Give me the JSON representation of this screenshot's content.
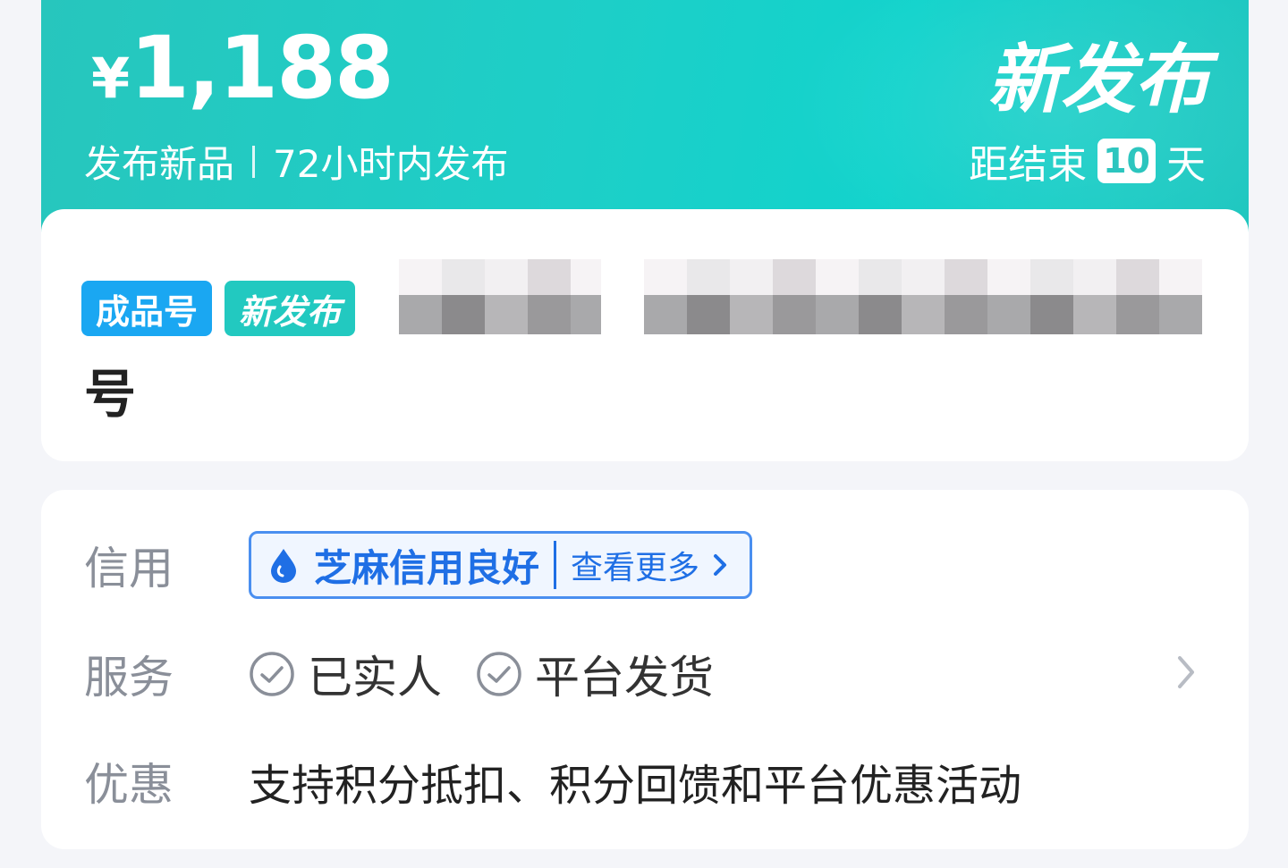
{
  "hero": {
    "currency": "¥",
    "price": "1,188",
    "subtitle_left": "发布新品",
    "subtitle_right": "72小时内发布",
    "badge": "新发布",
    "countdown_prefix": "距结束",
    "countdown_days": "10",
    "countdown_suffix": "天"
  },
  "title_card": {
    "tags": [
      "成品号",
      "新发布"
    ],
    "title_tail": "号"
  },
  "info": {
    "credit": {
      "label": "信用",
      "pill_text": "芝麻信用良好",
      "more_text": "查看更多"
    },
    "service": {
      "label": "服务",
      "items": [
        "已实人",
        "平台发货"
      ]
    },
    "promo": {
      "label": "优惠",
      "text": "支持积分抵扣、积分回馈和平台优惠活动"
    }
  },
  "colors": {
    "hero_teal": "#1dcfc8",
    "tag_blue": "#1aa7f2",
    "tag_teal": "#22c9c0",
    "credit_blue": "#1f6fe5"
  }
}
